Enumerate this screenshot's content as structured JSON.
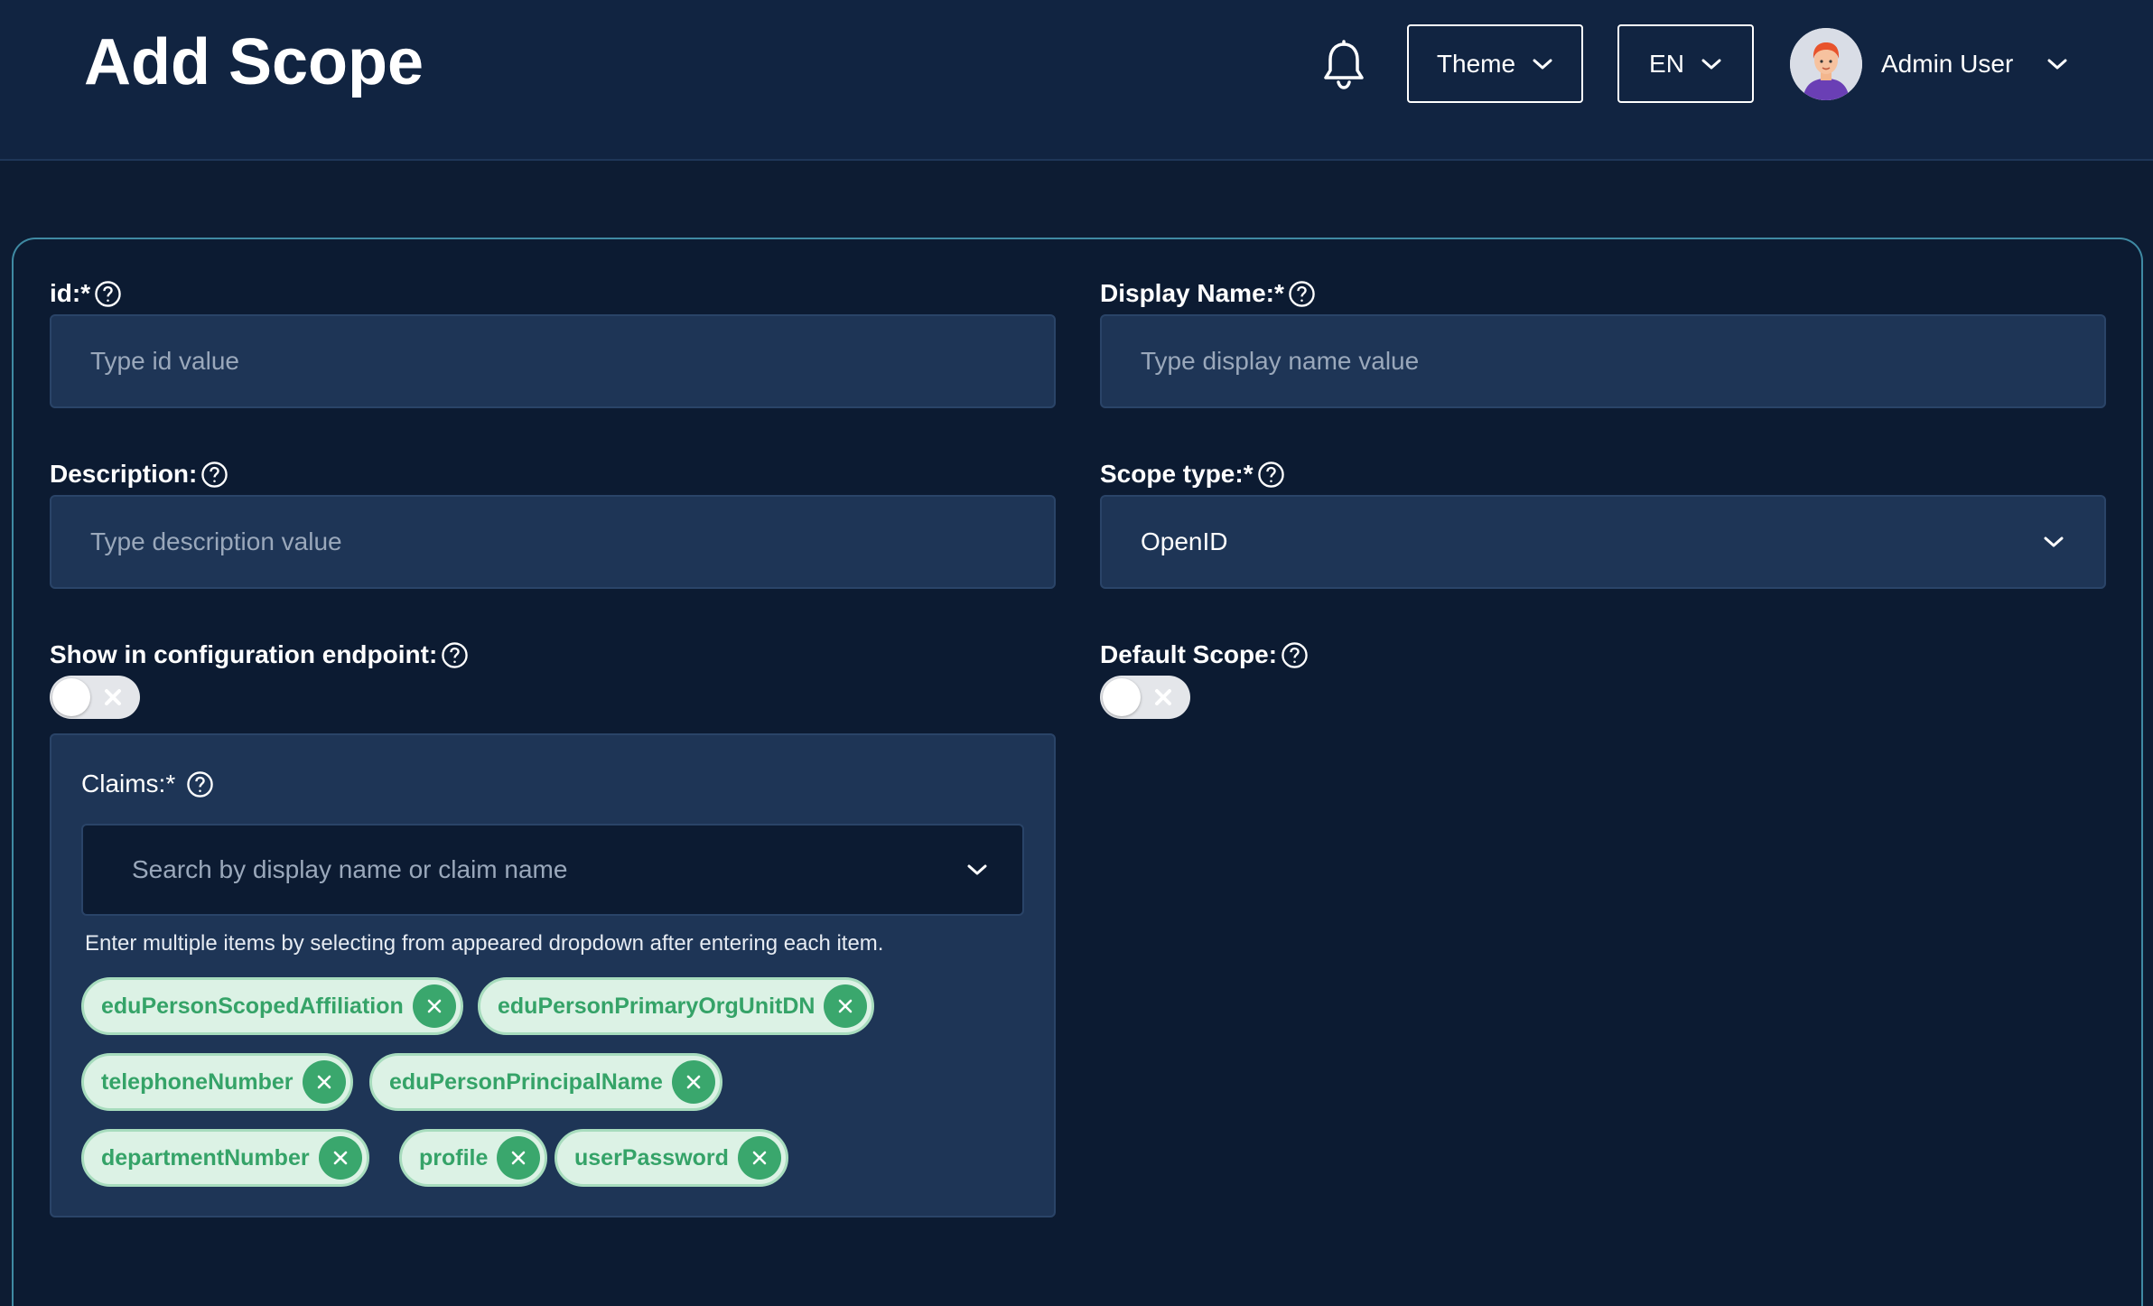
{
  "header": {
    "title": "Add Scope",
    "theme_label": "Theme",
    "lang_label": "EN",
    "user_name": "Admin User"
  },
  "form": {
    "id": {
      "label": "id:*",
      "placeholder": "Type id value"
    },
    "display_name": {
      "label": "Display Name:*",
      "placeholder": "Type display name value"
    },
    "description": {
      "label": "Description:",
      "placeholder": "Type description value"
    },
    "scope_type": {
      "label": "Scope type:*",
      "value": "OpenID"
    },
    "show_in_config": {
      "label": "Show in configuration endpoint:",
      "enabled": false
    },
    "default_scope": {
      "label": "Default Scope:",
      "enabled": false
    },
    "claims": {
      "label": "Claims:*",
      "placeholder": "Search by display name or claim name",
      "hint": "Enter multiple items by selecting from appeared dropdown after entering each item.",
      "selected": [
        "eduPersonScopedAffiliation",
        "eduPersonPrimaryOrgUnitDN",
        "telephoneNumber",
        "eduPersonPrincipalName",
        "departmentNumber",
        "profile",
        "userPassword"
      ]
    }
  },
  "colors": {
    "background": "#0d1c33",
    "header": "#112441",
    "field": "#1e3556",
    "chip_bg": "#dcf2e5",
    "chip_text": "#35a368",
    "card_border": "#3f8aa3"
  }
}
